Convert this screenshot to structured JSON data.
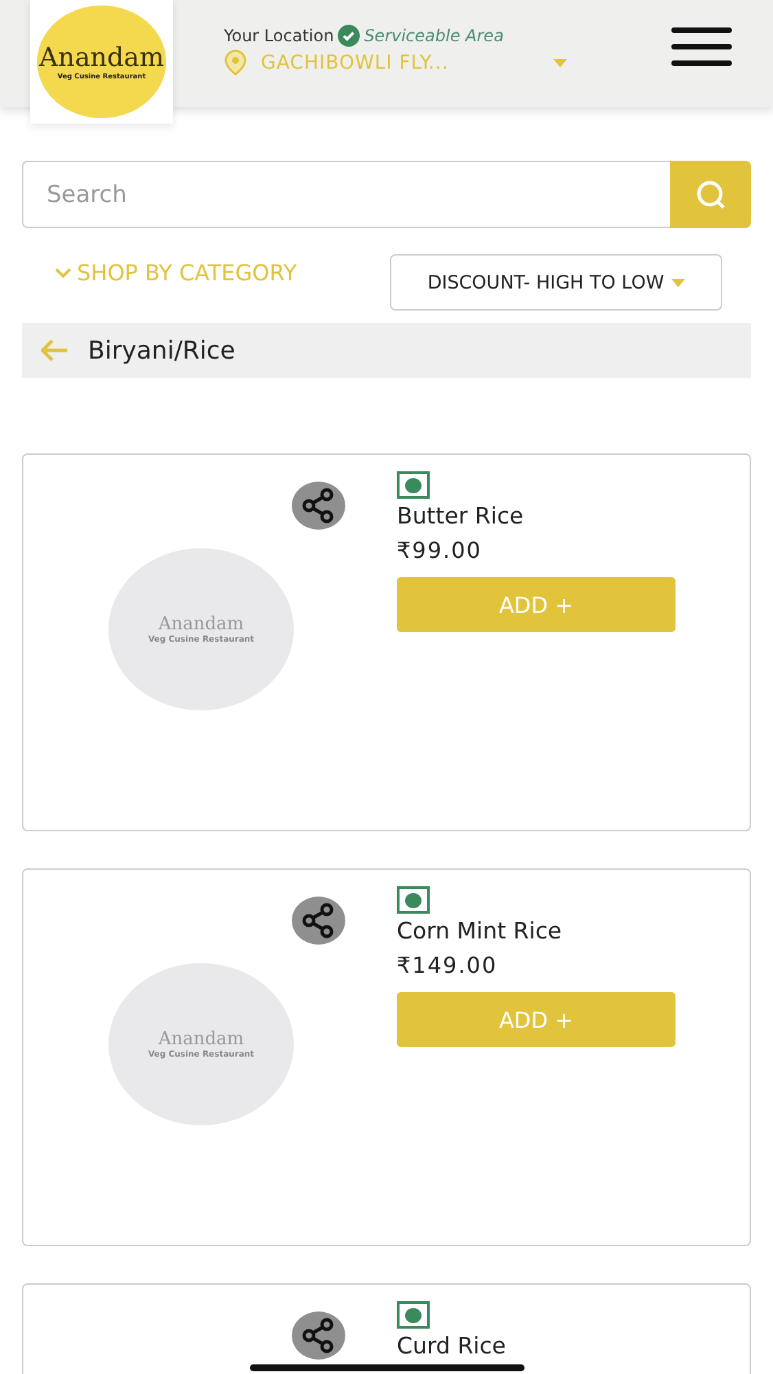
{
  "header": {
    "logo": {
      "title": "Anandam",
      "subtitle": "Veg Cusine Restaurant"
    },
    "location_label": "Your Location",
    "serviceable": true,
    "serviceable_text": "Serviceable Area",
    "location": "GACHIBOWLI FLY..."
  },
  "search": {
    "placeholder": "Search"
  },
  "shop_by_category": "SHOP BY CATEGORY",
  "sort": {
    "value": "DISCOUNT- HIGH TO LOW"
  },
  "breadcrumb": {
    "title": "Biryani/Rice"
  },
  "products": [
    {
      "name": "Butter Rice",
      "price": "₹99.00",
      "veg": true,
      "button": "ADD +",
      "logo_title": "Anandam",
      "logo_subtitle": "Veg Cusine Restaurant"
    },
    {
      "name": "Corn Mint Rice",
      "price": "₹149.00",
      "veg": true,
      "button": "ADD +",
      "logo_title": "Anandam",
      "logo_subtitle": "Veg Cusine Restaurant"
    },
    {
      "name": "Curd Rice",
      "veg": true
    }
  ]
}
